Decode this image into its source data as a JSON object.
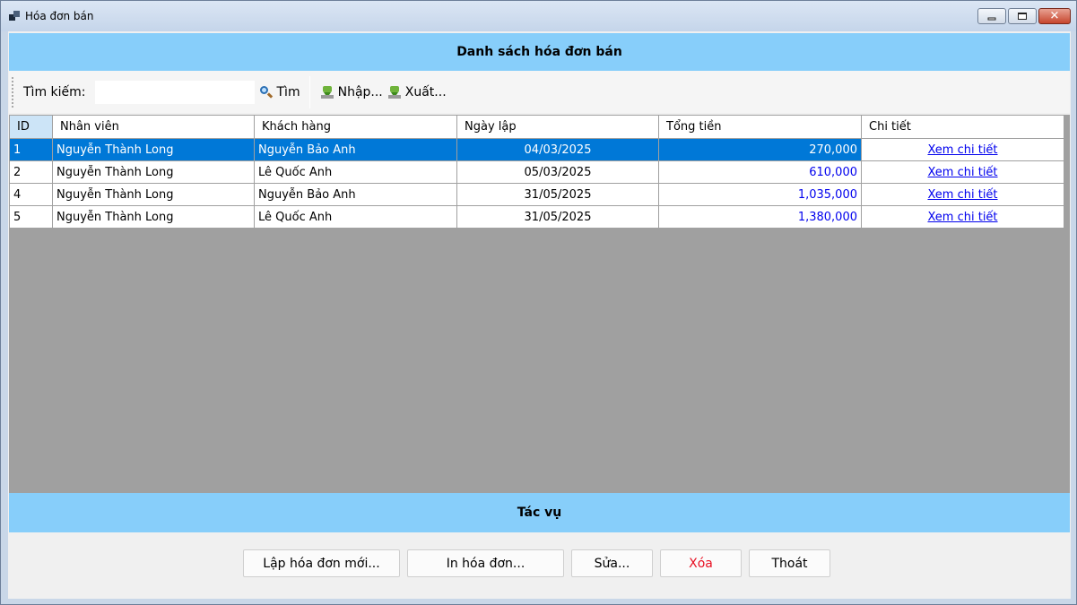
{
  "window": {
    "title": "Hóa đơn bán"
  },
  "header": {
    "title": "Danh sách hóa đơn bán"
  },
  "toolbar": {
    "search_label": "Tìm kiếm:",
    "search_value": "",
    "find_label": "Tìm",
    "import_label": "Nhập...",
    "export_label": "Xuất..."
  },
  "table": {
    "columns": [
      "ID",
      "Nhân viên",
      "Khách hàng",
      "Ngày lập",
      "Tổng tiền",
      "Chi tiết"
    ],
    "rows": [
      {
        "id": "1",
        "employee": "Nguyễn Thành Long",
        "customer": "Nguyễn Bảo Anh",
        "date": "04/03/2025",
        "total": "270,000",
        "detail": "Xem chi tiết",
        "selected": true
      },
      {
        "id": "2",
        "employee": "Nguyễn Thành Long",
        "customer": "Lê Quốc Anh",
        "date": "05/03/2025",
        "total": "610,000",
        "detail": "Xem chi tiết",
        "selected": false
      },
      {
        "id": "4",
        "employee": "Nguyễn Thành Long",
        "customer": "Nguyễn Bảo Anh",
        "date": "31/05/2025",
        "total": "1,035,000",
        "detail": "Xem chi tiết",
        "selected": false
      },
      {
        "id": "5",
        "employee": "Nguyễn Thành Long",
        "customer": "Lê Quốc Anh",
        "date": "31/05/2025",
        "total": "1,380,000",
        "detail": "Xem chi tiết",
        "selected": false
      }
    ]
  },
  "actions": {
    "title": "Tác vụ",
    "new_invoice": "Lập hóa đơn mới...",
    "print_invoice": "In hóa đơn...",
    "edit": "Sửa...",
    "delete": "Xóa",
    "exit": "Thoát"
  },
  "colors": {
    "band": "#87cefa",
    "selection": "#0078d7",
    "link": "#0000ee",
    "delete_text": "#e81123",
    "grid_background": "#a0a0a0"
  }
}
